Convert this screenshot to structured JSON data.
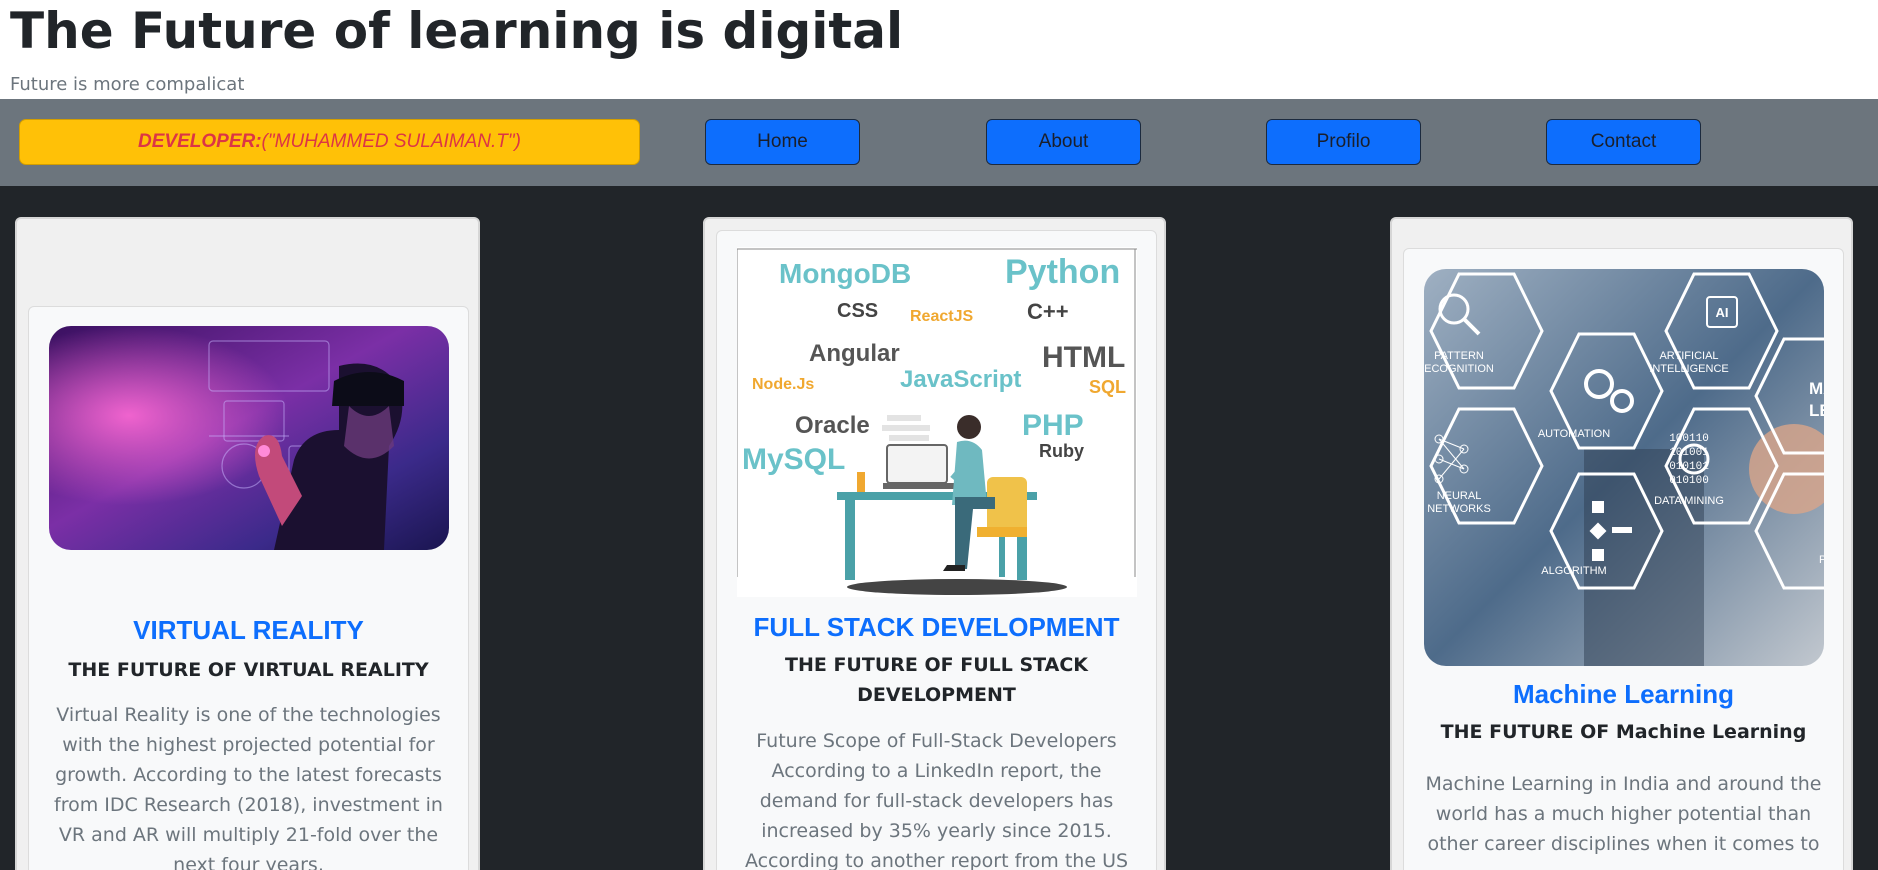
{
  "header": {
    "title": "The Future of learning is digital",
    "subtitle": "Future is more compalicat"
  },
  "navbar": {
    "developer_label": "DEVELOPER:",
    "developer_name": "(\"MUHAMMED SULAIMAN.T\")",
    "items": [
      {
        "label": "Home"
      },
      {
        "label": "About"
      },
      {
        "label": "Profilo"
      },
      {
        "label": "Contact"
      }
    ]
  },
  "colors": {
    "navbar_bg": "#6c757d",
    "content_bg": "#212529",
    "badge_bg": "#ffc107",
    "badge_text": "#dc3545",
    "button_bg": "#0d6efd",
    "card_title": "#0d6efd"
  },
  "cards": [
    {
      "title": "VIRTUAL REALITY",
      "subtitle": "THE FUTURE OF VIRTUAL REALITY",
      "text": "Virtual Reality is one of the technologies with the highest projected potential for growth. According to the latest forecasts from IDC Research (2018), investment in VR and AR will multiply 21-fold over the next four years,"
    },
    {
      "title": "FULL STACK DEVELOPMENT",
      "subtitle": "THE FUTURE OF FULL STACK DEVELOPMENT",
      "text": "Future Scope of Full-Stack Developers According to a LinkedIn report, the demand for full-stack developers has increased by 35% yearly since 2015. According to another report from the US Bureau of Labor Statistics,",
      "image_words": [
        "MongoDB",
        "Python",
        "CSS",
        "ReactJS",
        "C++",
        "Angular",
        "HTML",
        "Node.Js",
        "JavaScript",
        "SQL",
        "Oracle",
        "PHP",
        "MySQL",
        "Ruby"
      ]
    },
    {
      "title": "Machine Learning",
      "subtitle": "THE FUTURE OF Machine Learning",
      "text": "Machine Learning in India and around the world has a much higher potential than other career disciplines when it comes to",
      "image_labels": {
        "pattern": "PATTERN ECOGNITION",
        "ai_badge": "AI",
        "ai": "ARTIFICIAL INTELLIGENCE",
        "ml": "MACH LEARN",
        "automation": "AUTOMATION",
        "neural": "NEURAL NETWORKS",
        "binary": [
          "100110",
          "101001",
          "010101",
          "010100"
        ],
        "data_mining": "DATA MINING",
        "algorithm": "ALGORITHM",
        "problem": "PROBLE SOLVIN"
      }
    }
  ]
}
